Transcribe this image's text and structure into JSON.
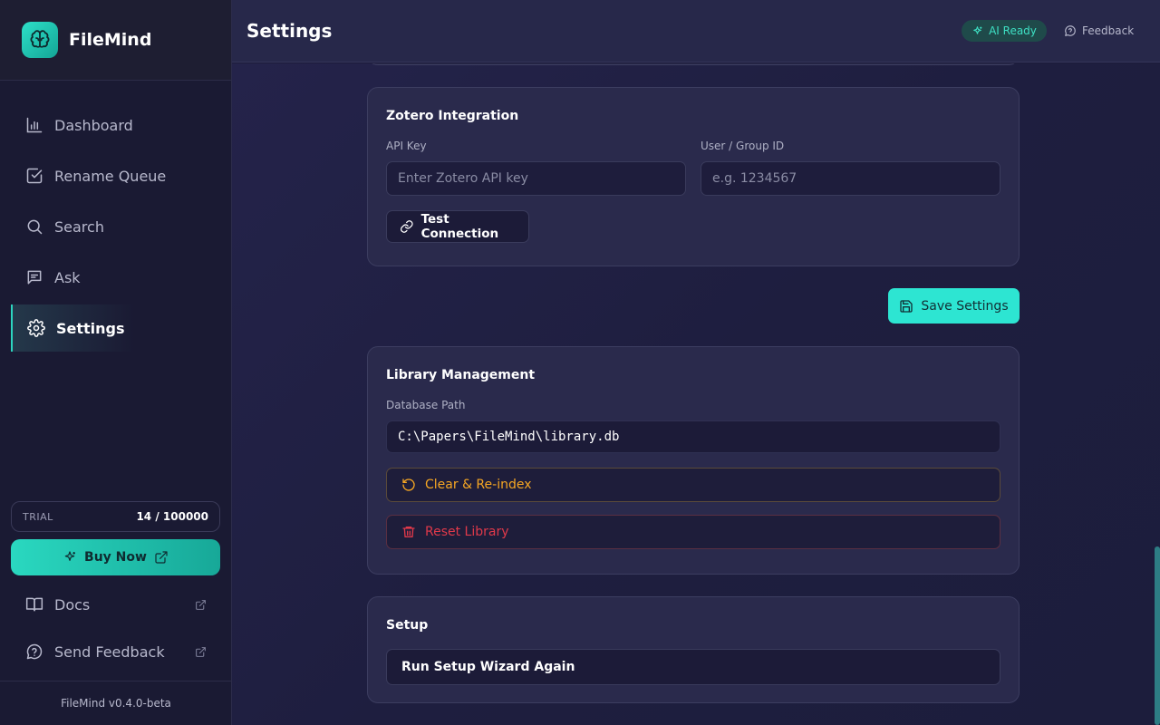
{
  "app": {
    "name": "FileMind",
    "version": "FileMind v0.4.0-beta"
  },
  "sidebar": {
    "items": [
      {
        "label": "Dashboard",
        "icon": "bar-chart-icon"
      },
      {
        "label": "Rename Queue",
        "icon": "checkbox-icon"
      },
      {
        "label": "Search",
        "icon": "search-icon"
      },
      {
        "label": "Ask",
        "icon": "message-icon"
      },
      {
        "label": "Settings",
        "icon": "gear-icon",
        "active": true
      }
    ],
    "trial": {
      "label": "TRIAL",
      "count": "14 / 100000"
    },
    "buy_label": "Buy Now",
    "docs_label": "Docs",
    "feedback_label": "Send Feedback"
  },
  "header": {
    "title": "Settings",
    "ai_status": "AI Ready",
    "feedback_label": "Feedback"
  },
  "zotero": {
    "title": "Zotero Integration",
    "api_key_label": "API Key",
    "api_key_placeholder": "Enter Zotero API key",
    "user_id_label": "User / Group ID",
    "user_id_placeholder": "e.g. 1234567",
    "test_label": "Test Connection"
  },
  "save_label": "Save Settings",
  "library": {
    "title": "Library Management",
    "db_label": "Database Path",
    "db_path": "C:\\Papers\\FileMind\\library.db",
    "reindex_label": "Clear & Re-index",
    "reset_label": "Reset Library"
  },
  "setup": {
    "title": "Setup",
    "wizard_label": "Run Setup Wizard Again"
  },
  "colors": {
    "accent": "#2dd4bf",
    "warning": "#f59e0b",
    "danger": "#e0394a",
    "bg": "#1c1b3a"
  }
}
